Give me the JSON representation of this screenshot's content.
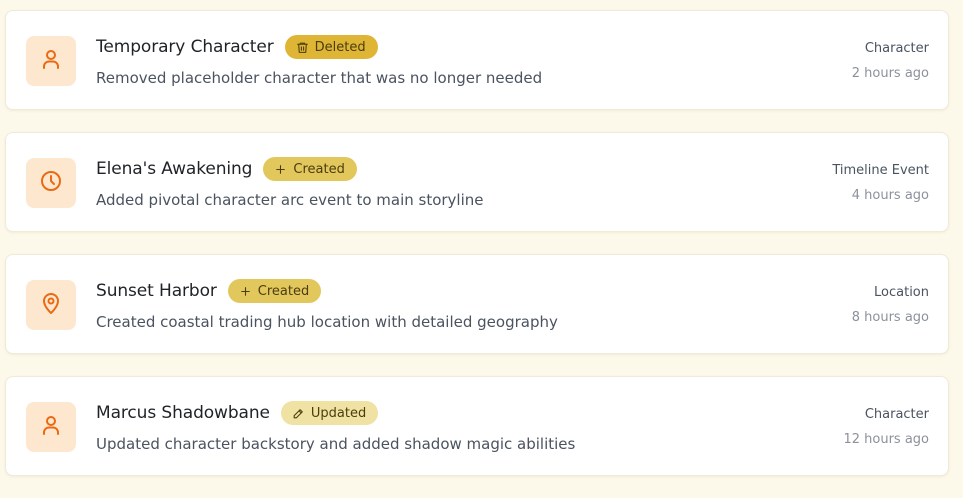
{
  "colors": {
    "page_bg": "#fcf8ea",
    "card_bg": "#ffffff",
    "icon_bg": "#fde8cf",
    "icon_stroke": "#ea6a14",
    "badge_deleted": "#dfb536",
    "badge_created": "#e2c75d",
    "badge_updated": "#f0e2a3"
  },
  "activities": [
    {
      "icon": "user-icon",
      "title": "Temporary Character",
      "badge": {
        "label": "Deleted",
        "icon": "trash-icon",
        "color": "#dfb536"
      },
      "description": "Removed placeholder character that was no longer needed",
      "type": "Character",
      "time": "2 hours ago"
    },
    {
      "icon": "clock-icon",
      "title": "Elena's Awakening",
      "badge": {
        "label": "Created",
        "icon": "plus-icon",
        "color": "#e2c75d"
      },
      "description": "Added pivotal character arc event to main storyline",
      "type": "Timeline Event",
      "time": "4 hours ago"
    },
    {
      "icon": "map-pin-icon",
      "title": "Sunset Harbor",
      "badge": {
        "label": "Created",
        "icon": "plus-icon",
        "color": "#e2c75d"
      },
      "description": "Created coastal trading hub location with detailed geography",
      "type": "Location",
      "time": "8 hours ago"
    },
    {
      "icon": "user-icon",
      "title": "Marcus Shadowbane",
      "badge": {
        "label": "Updated",
        "icon": "pencil-icon",
        "color": "#f0e2a3"
      },
      "description": "Updated character backstory and added shadow magic abilities",
      "type": "Character",
      "time": "12 hours ago"
    }
  ]
}
